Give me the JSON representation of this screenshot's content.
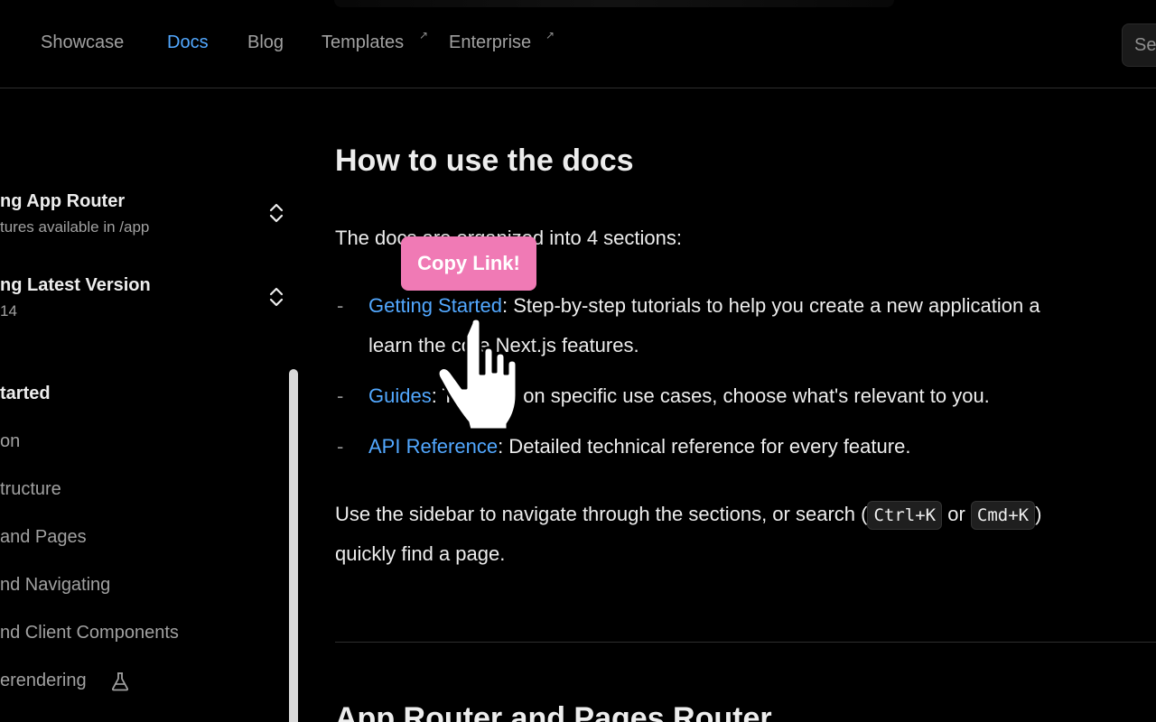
{
  "topnav": {
    "items": [
      {
        "label": "Showcase"
      },
      {
        "label": "Docs"
      },
      {
        "label": "Blog"
      },
      {
        "label": "Templates",
        "external_marker": "↗"
      },
      {
        "label": "Enterprise",
        "external_marker": "↗"
      }
    ],
    "search_placeholder": "Se"
  },
  "sidebar": {
    "router_switcher": {
      "title": "ng App Router",
      "subtitle": "tures available in /app"
    },
    "version_switcher": {
      "title": "ng Latest Version",
      "subtitle": "14"
    },
    "section_title": "tarted",
    "links": [
      "on",
      "tructure",
      "and Pages",
      "nd Navigating",
      "nd Client Components",
      "erendering"
    ]
  },
  "content": {
    "heading": "How to use the docs",
    "intro": "The docs are organized into 4 sections:",
    "list": [
      {
        "link": "Getting Started",
        "text": ": Step-by-step tutorials to help you create a new application a",
        "text2": "learn the core Next.js features."
      },
      {
        "link": "Guides",
        "text": ": Tutorials on specific use cases, choose what's relevant to you."
      },
      {
        "link": "API Reference",
        "text": ": Detailed technical reference for every feature."
      }
    ],
    "outro_before": "Use the sidebar to navigate through the sections, or search (",
    "kbd1": "Ctrl+K",
    "outro_or": " or ",
    "kbd2": "Cmd+K",
    "outro_after": ")",
    "outro_line2": "quickly find a page.",
    "next_heading": "App Router and Pages Router"
  },
  "overlay": {
    "tooltip": "Copy Link!"
  },
  "colors": {
    "background": "#000000",
    "link": "#52a8ff",
    "tooltip": "#f07ab5"
  }
}
